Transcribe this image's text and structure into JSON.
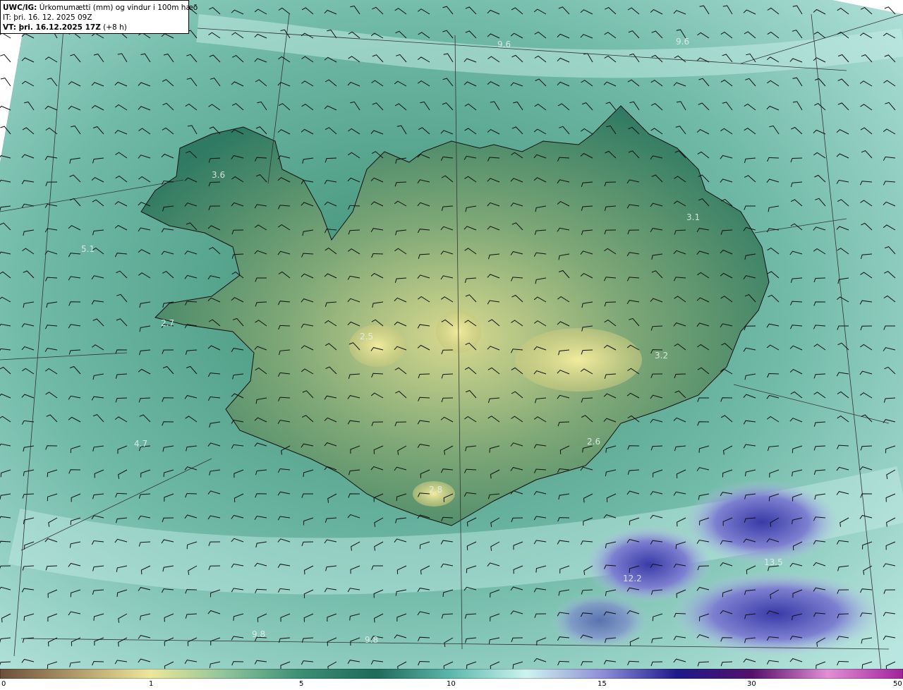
{
  "header": {
    "model": "UWC/IG:",
    "title": "Úrkomumætti (mm) og vindur i 100m hæð",
    "it_label": "IT:",
    "it_value": "þri. 16. 12. 2025 09Z",
    "vt_label": "VT: þri. 16.12.2025 17Z",
    "vt_offset": "(+8 h)"
  },
  "value_labels": [
    {
      "text": "9.6",
      "id": "vl-1"
    },
    {
      "text": "9.6",
      "id": "vl-2"
    },
    {
      "text": "3.6",
      "id": "vl-3"
    },
    {
      "text": "5.1",
      "id": "vl-4"
    },
    {
      "text": "3.1",
      "id": "vl-5"
    },
    {
      "text": "2.7",
      "id": "vl-6"
    },
    {
      "text": "2.5",
      "id": "vl-7"
    },
    {
      "text": "3.2",
      "id": "vl-8"
    },
    {
      "text": "4.7",
      "id": "vl-9"
    },
    {
      "text": "2.6",
      "id": "vl-10"
    },
    {
      "text": "2.8",
      "id": "vl-11"
    },
    {
      "text": "13.5",
      "id": "vl-12"
    },
    {
      "text": "12.2",
      "id": "vl-13"
    },
    {
      "text": "9.8",
      "id": "vl-14"
    },
    {
      "text": "9.8",
      "id": "vl-15"
    }
  ],
  "colorbar": {
    "ticks": [
      "0",
      "1",
      "5",
      "10",
      "15",
      "30",
      "50"
    ],
    "colors": [
      "#6b4f3a",
      "#b09a6a",
      "#ece79b",
      "#8fc49a",
      "#3b8f74",
      "#1f6a5a",
      "#5db9ad",
      "#cdf3ef",
      "#8f8fd8",
      "#1c1a8c",
      "#55106a",
      "#e28fd6",
      "#a0229a"
    ]
  }
}
